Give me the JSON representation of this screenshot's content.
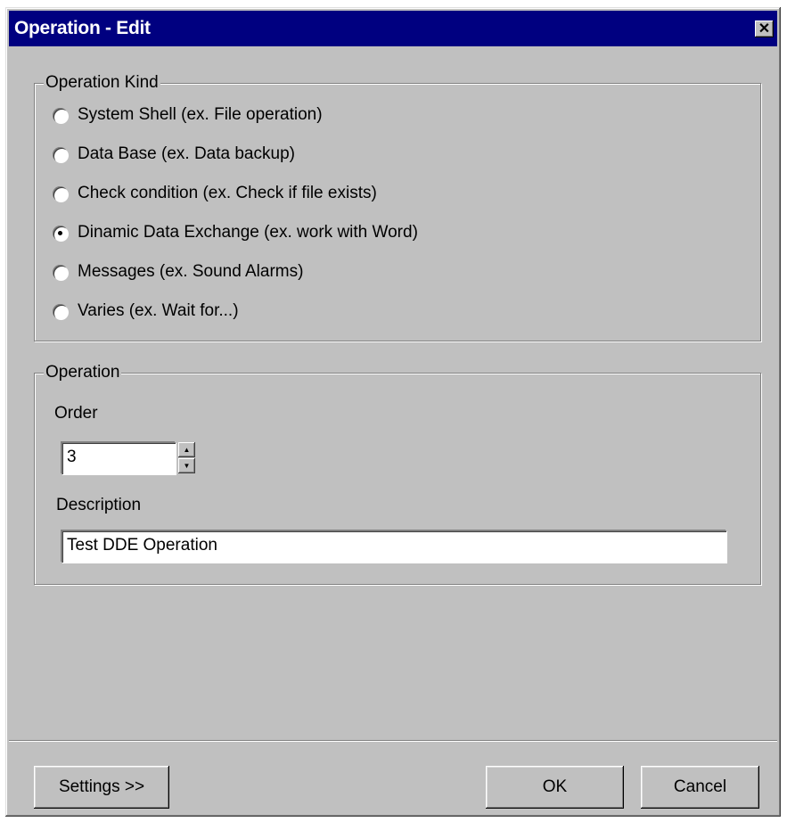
{
  "window": {
    "title": "Operation - Edit",
    "close_glyph": "✕"
  },
  "operation_kind": {
    "legend": "Operation Kind",
    "options": [
      {
        "label": "System Shell (ex. File operation)",
        "selected": false
      },
      {
        "label": "Data Base (ex. Data backup)",
        "selected": false
      },
      {
        "label": "Check condition (ex. Check if file exists)",
        "selected": false
      },
      {
        "label": "Dinamic Data Exchange (ex. work with Word)",
        "selected": true
      },
      {
        "label": "Messages (ex. Sound Alarms)",
        "selected": false
      },
      {
        "label": "Varies (ex. Wait for...)",
        "selected": false
      }
    ]
  },
  "operation": {
    "legend": "Operation",
    "order_label": "Order",
    "order_value": "3",
    "description_label": "Description",
    "description_value": "Test DDE Operation"
  },
  "buttons": {
    "settings": "Settings >>",
    "ok": "OK",
    "cancel": "Cancel"
  },
  "colors": {
    "titlebar": "#000080",
    "face": "#c0c0c0"
  }
}
